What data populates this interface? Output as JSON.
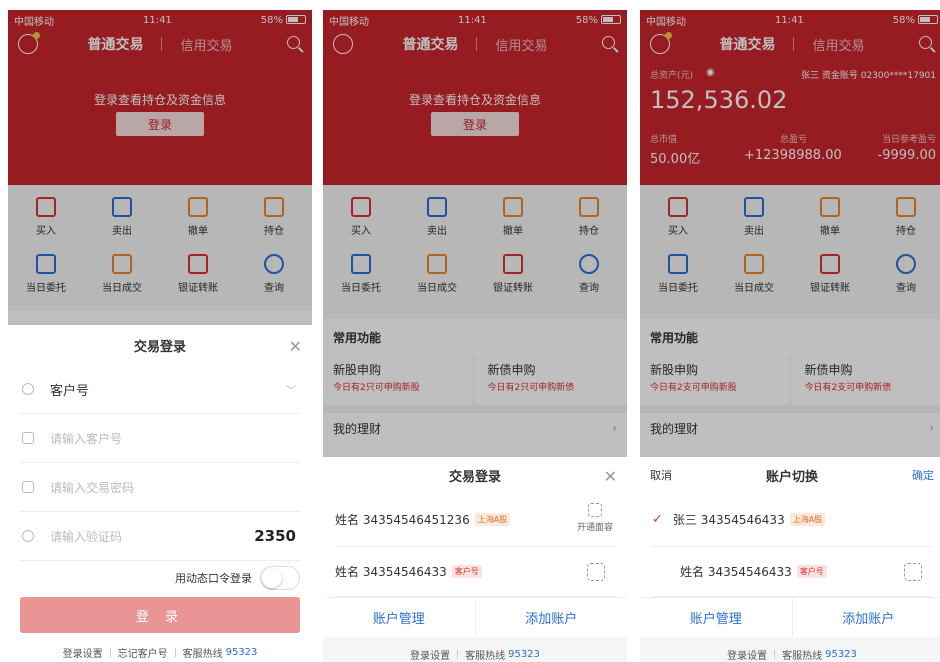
{
  "status": {
    "carrier": "中国移动",
    "time": "11:41",
    "battery": "58%"
  },
  "header": {
    "tab_normal": "普通交易",
    "tab_credit": "信用交易"
  },
  "banner": {
    "prompt": "登录查看持仓及资金信息",
    "login_button": "登录"
  },
  "assets": {
    "total_label": "总资产(元)",
    "account_info": "张三 资金账号 02300****17901",
    "total_value": "152,536.02",
    "market_label": "总市值",
    "market_value": "50.00亿",
    "pnl_label": "总盈亏",
    "pnl_value": "+12398988.00",
    "ref_label": "当日参考盈亏",
    "ref_value": "-9999.00"
  },
  "grid": [
    "买入",
    "卖出",
    "撤单",
    "持仓",
    "当日委托",
    "当日成交",
    "银证转账",
    "查询"
  ],
  "common": {
    "section_title": "常用功能",
    "ipo_stock_title": "新股申购",
    "ipo_stock_sub_2": "今日有2只可申购新股",
    "ipo_bond_title": "新债申购",
    "ipo_bond_sub_2": "今日有2只可申购新债",
    "ipo_stock_sub_3": "今日有2支可申购新股",
    "ipo_bond_sub_3": "今日有2支可申购新债",
    "wealth_title": "我的理财"
  },
  "login_form": {
    "title": "交易登录",
    "customer_type": "客户号",
    "customer_placeholder": "请输入客户号",
    "password_placeholder": "请输入交易密码",
    "captcha_placeholder": "请输入验证码",
    "captcha_code": "2350",
    "dynamic_login": "用动态口令登录",
    "submit": "登 录"
  },
  "footer": {
    "settings": "登录设置",
    "forgot": "忘记客户号",
    "hotline_label": "客服热线",
    "hotline": "95323"
  },
  "accounts": {
    "title": "交易登录",
    "account1": "姓名 34354546451236",
    "account1_tag": "上海A股",
    "face_label": "开通面容",
    "account2": "姓名 34354546433",
    "account2_tag": "客户号",
    "manage": "账户管理",
    "add": "添加账户"
  },
  "switch": {
    "cancel": "取消",
    "title": "账户切换",
    "confirm": "确定",
    "account1": "张三 34354546433",
    "account1_tag": "上海A股",
    "account2": "姓名 34354546433",
    "account2_tag": "客户号"
  }
}
